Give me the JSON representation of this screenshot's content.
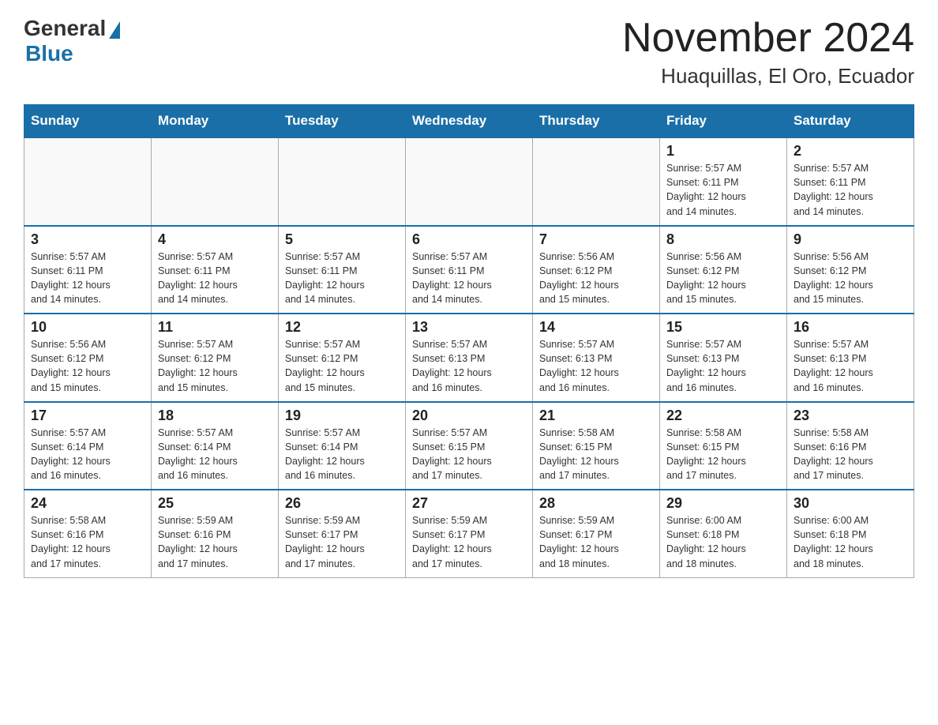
{
  "header": {
    "logo_general": "General",
    "logo_blue": "Blue",
    "month_title": "November 2024",
    "location": "Huaquillas, El Oro, Ecuador"
  },
  "weekdays": [
    "Sunday",
    "Monday",
    "Tuesday",
    "Wednesday",
    "Thursday",
    "Friday",
    "Saturday"
  ],
  "weeks": [
    [
      {
        "day": "",
        "info": ""
      },
      {
        "day": "",
        "info": ""
      },
      {
        "day": "",
        "info": ""
      },
      {
        "day": "",
        "info": ""
      },
      {
        "day": "",
        "info": ""
      },
      {
        "day": "1",
        "info": "Sunrise: 5:57 AM\nSunset: 6:11 PM\nDaylight: 12 hours\nand 14 minutes."
      },
      {
        "day": "2",
        "info": "Sunrise: 5:57 AM\nSunset: 6:11 PM\nDaylight: 12 hours\nand 14 minutes."
      }
    ],
    [
      {
        "day": "3",
        "info": "Sunrise: 5:57 AM\nSunset: 6:11 PM\nDaylight: 12 hours\nand 14 minutes."
      },
      {
        "day": "4",
        "info": "Sunrise: 5:57 AM\nSunset: 6:11 PM\nDaylight: 12 hours\nand 14 minutes."
      },
      {
        "day": "5",
        "info": "Sunrise: 5:57 AM\nSunset: 6:11 PM\nDaylight: 12 hours\nand 14 minutes."
      },
      {
        "day": "6",
        "info": "Sunrise: 5:57 AM\nSunset: 6:11 PM\nDaylight: 12 hours\nand 14 minutes."
      },
      {
        "day": "7",
        "info": "Sunrise: 5:56 AM\nSunset: 6:12 PM\nDaylight: 12 hours\nand 15 minutes."
      },
      {
        "day": "8",
        "info": "Sunrise: 5:56 AM\nSunset: 6:12 PM\nDaylight: 12 hours\nand 15 minutes."
      },
      {
        "day": "9",
        "info": "Sunrise: 5:56 AM\nSunset: 6:12 PM\nDaylight: 12 hours\nand 15 minutes."
      }
    ],
    [
      {
        "day": "10",
        "info": "Sunrise: 5:56 AM\nSunset: 6:12 PM\nDaylight: 12 hours\nand 15 minutes."
      },
      {
        "day": "11",
        "info": "Sunrise: 5:57 AM\nSunset: 6:12 PM\nDaylight: 12 hours\nand 15 minutes."
      },
      {
        "day": "12",
        "info": "Sunrise: 5:57 AM\nSunset: 6:12 PM\nDaylight: 12 hours\nand 15 minutes."
      },
      {
        "day": "13",
        "info": "Sunrise: 5:57 AM\nSunset: 6:13 PM\nDaylight: 12 hours\nand 16 minutes."
      },
      {
        "day": "14",
        "info": "Sunrise: 5:57 AM\nSunset: 6:13 PM\nDaylight: 12 hours\nand 16 minutes."
      },
      {
        "day": "15",
        "info": "Sunrise: 5:57 AM\nSunset: 6:13 PM\nDaylight: 12 hours\nand 16 minutes."
      },
      {
        "day": "16",
        "info": "Sunrise: 5:57 AM\nSunset: 6:13 PM\nDaylight: 12 hours\nand 16 minutes."
      }
    ],
    [
      {
        "day": "17",
        "info": "Sunrise: 5:57 AM\nSunset: 6:14 PM\nDaylight: 12 hours\nand 16 minutes."
      },
      {
        "day": "18",
        "info": "Sunrise: 5:57 AM\nSunset: 6:14 PM\nDaylight: 12 hours\nand 16 minutes."
      },
      {
        "day": "19",
        "info": "Sunrise: 5:57 AM\nSunset: 6:14 PM\nDaylight: 12 hours\nand 16 minutes."
      },
      {
        "day": "20",
        "info": "Sunrise: 5:57 AM\nSunset: 6:15 PM\nDaylight: 12 hours\nand 17 minutes."
      },
      {
        "day": "21",
        "info": "Sunrise: 5:58 AM\nSunset: 6:15 PM\nDaylight: 12 hours\nand 17 minutes."
      },
      {
        "day": "22",
        "info": "Sunrise: 5:58 AM\nSunset: 6:15 PM\nDaylight: 12 hours\nand 17 minutes."
      },
      {
        "day": "23",
        "info": "Sunrise: 5:58 AM\nSunset: 6:16 PM\nDaylight: 12 hours\nand 17 minutes."
      }
    ],
    [
      {
        "day": "24",
        "info": "Sunrise: 5:58 AM\nSunset: 6:16 PM\nDaylight: 12 hours\nand 17 minutes."
      },
      {
        "day": "25",
        "info": "Sunrise: 5:59 AM\nSunset: 6:16 PM\nDaylight: 12 hours\nand 17 minutes."
      },
      {
        "day": "26",
        "info": "Sunrise: 5:59 AM\nSunset: 6:17 PM\nDaylight: 12 hours\nand 17 minutes."
      },
      {
        "day": "27",
        "info": "Sunrise: 5:59 AM\nSunset: 6:17 PM\nDaylight: 12 hours\nand 17 minutes."
      },
      {
        "day": "28",
        "info": "Sunrise: 5:59 AM\nSunset: 6:17 PM\nDaylight: 12 hours\nand 18 minutes."
      },
      {
        "day": "29",
        "info": "Sunrise: 6:00 AM\nSunset: 6:18 PM\nDaylight: 12 hours\nand 18 minutes."
      },
      {
        "day": "30",
        "info": "Sunrise: 6:00 AM\nSunset: 6:18 PM\nDaylight: 12 hours\nand 18 minutes."
      }
    ]
  ]
}
